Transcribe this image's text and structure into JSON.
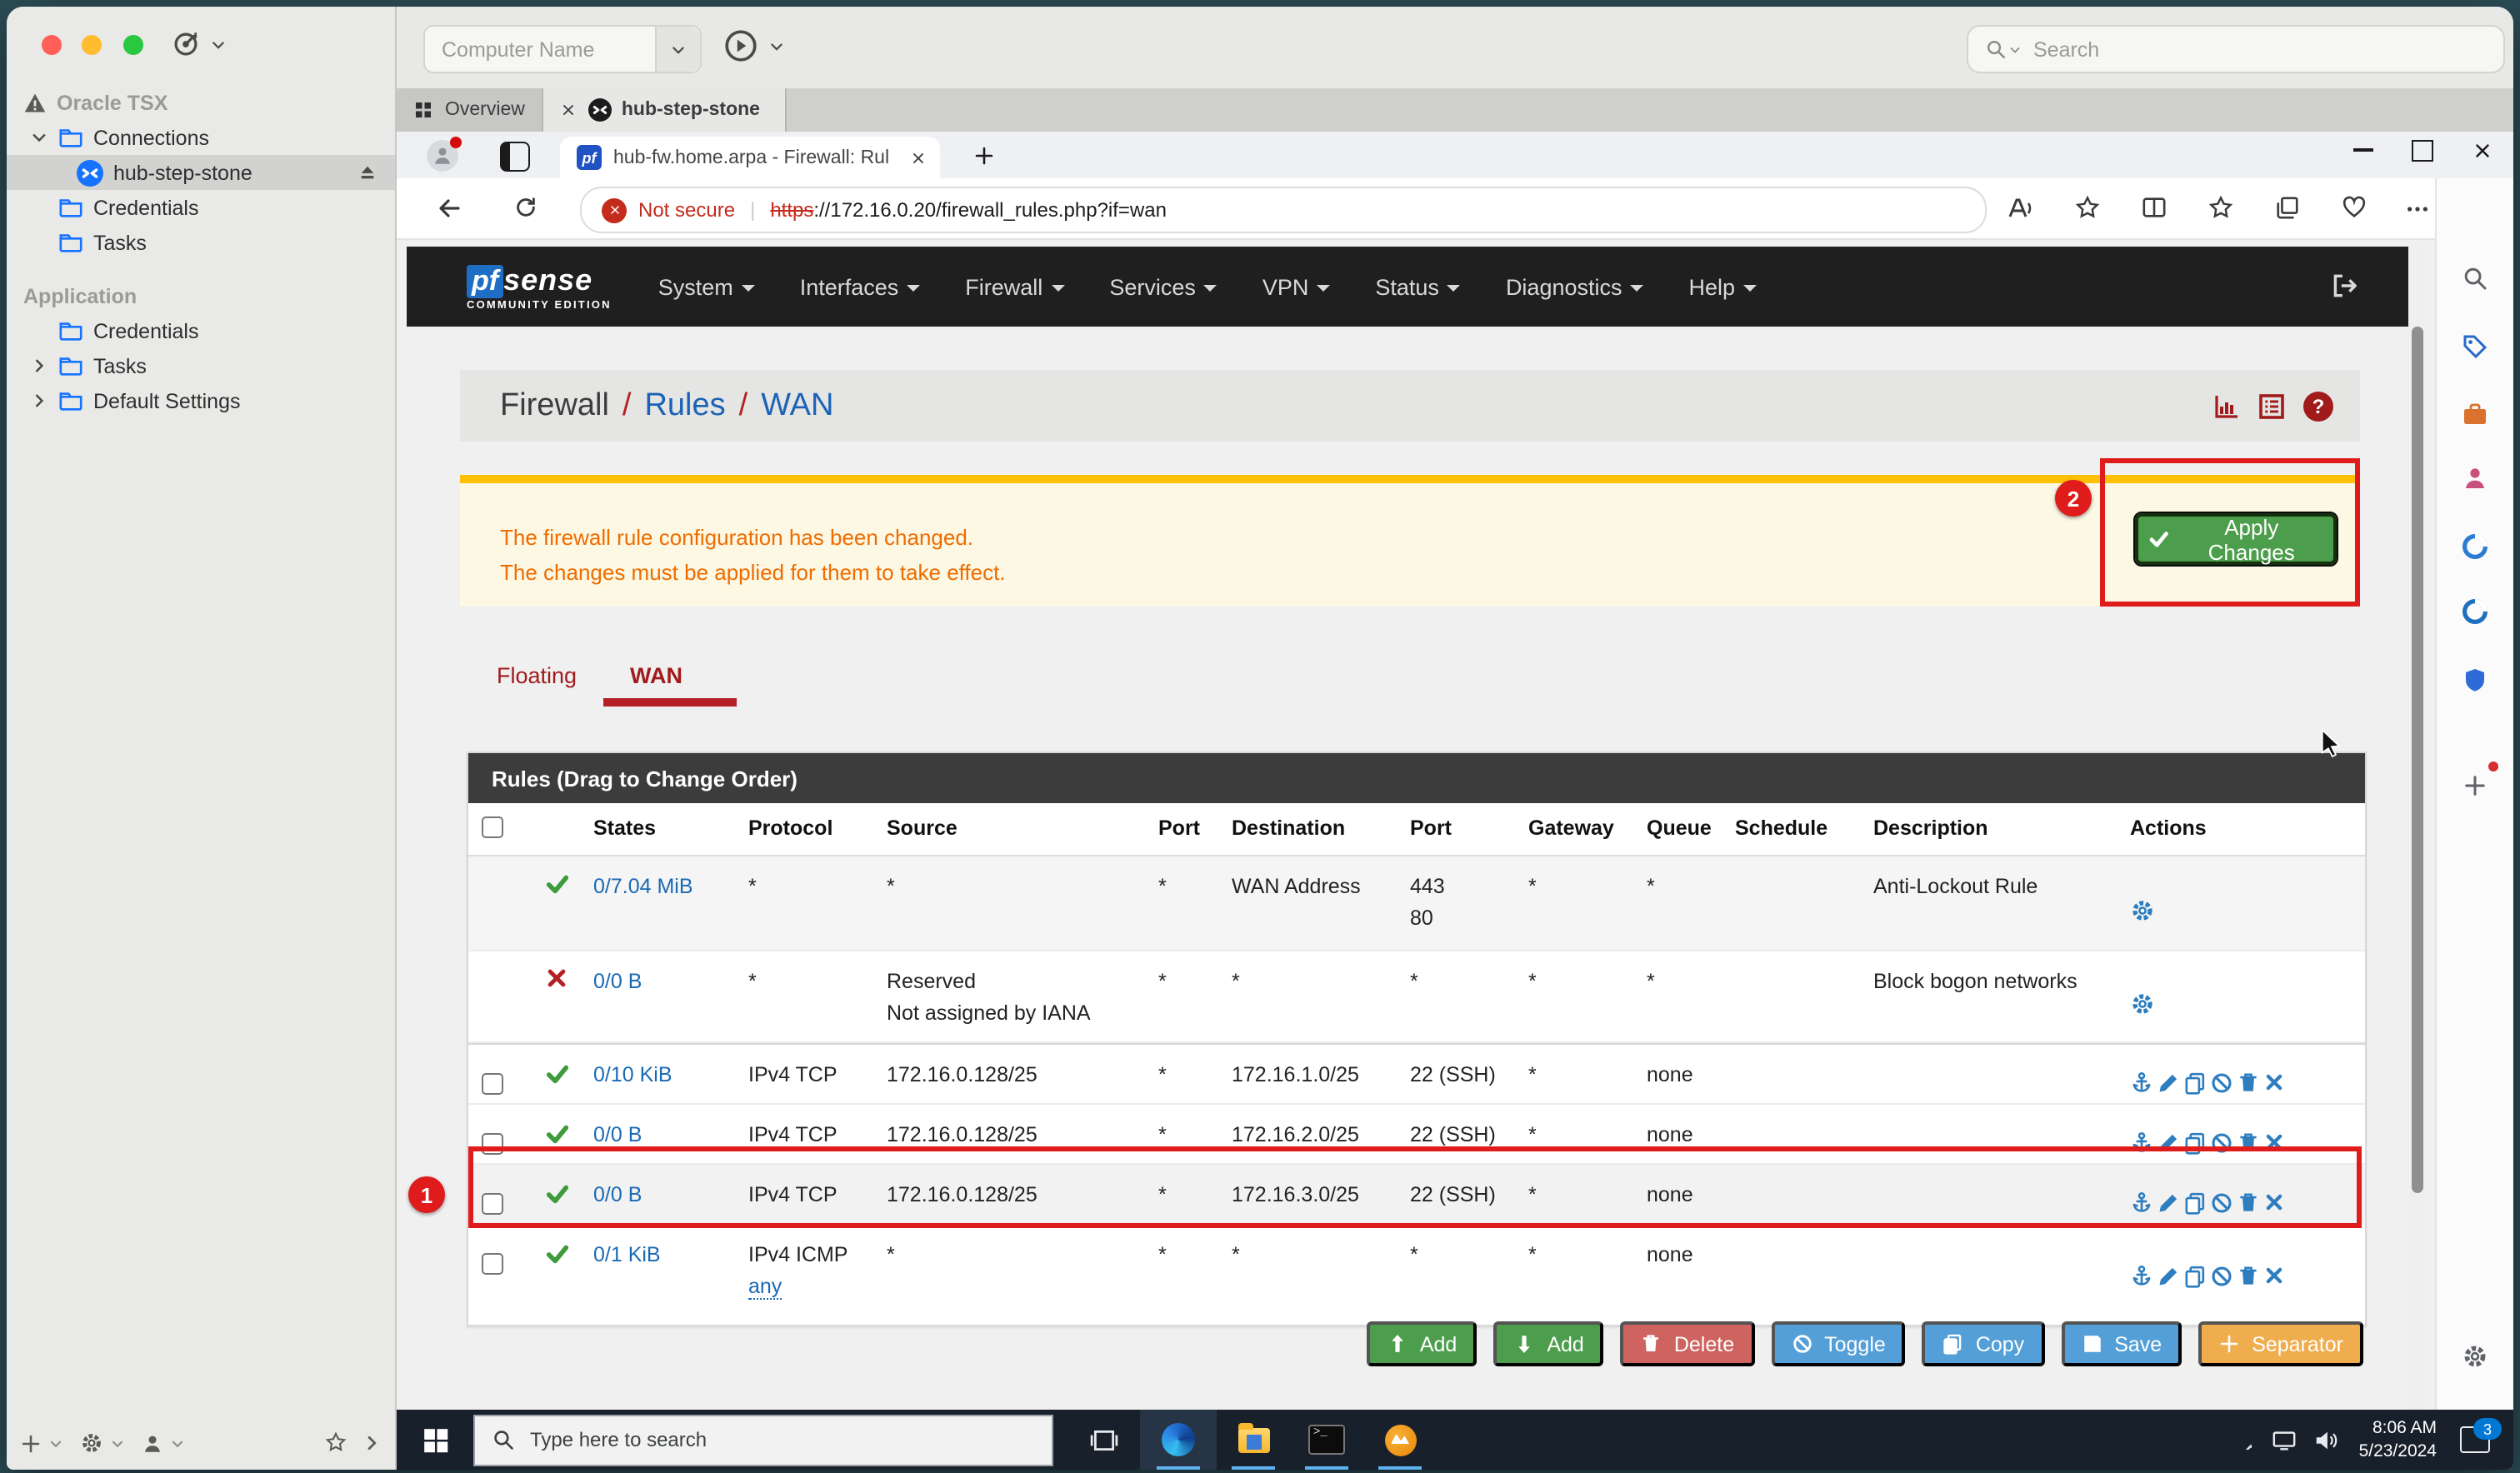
{
  "colors": {
    "wallpaper_teal": "#2d4f58",
    "pfsense_navbar": "#1f1f1f",
    "alert_bg": "#fcf8e3",
    "alert_border": "#ffc107",
    "alert_text": "#ef6c00",
    "success_green": "#4c9e4c",
    "btn_green": "#5cb85c",
    "btn_red": "#d9534f",
    "btn_blue": "#549fd7",
    "btn_orange": "#f0ad4e",
    "annotation_red": "#e01b1b",
    "pf_tab_red": "#a01b1b",
    "pf_icon_red": "#a11b1b",
    "link_blue": "#1a69b5",
    "action_icon_blue": "#2d7dbf",
    "taskbar_bg": "#18202b"
  },
  "connection_manager": {
    "computer_name_placeholder": "Computer Name",
    "search_placeholder": "Search",
    "sidebar": {
      "root_label": "Oracle TSX",
      "connections_label": "Connections",
      "connection_name": "hub-step-stone",
      "credentials_label": "Credentials",
      "tasks_label": "Tasks",
      "section_label": "Application",
      "app_credentials_label": "Credentials",
      "app_tasks_label": "Tasks",
      "app_default_settings_label": "Default Settings"
    },
    "tabs": {
      "overview": "Overview",
      "session": "hub-step-stone"
    }
  },
  "browser": {
    "tab_title": "hub-fw.home.arpa - Firewall: Rul",
    "favicon_text": "pf",
    "security_label": "Not secure",
    "url_scheme": "https",
    "url_rest": "://172.16.0.20/firewall_rules.php?if=wan"
  },
  "pfsense": {
    "logo_prefix": "pf",
    "logo_suffix": "sense",
    "logo_edition": "COMMUNITY EDITION",
    "nav": [
      {
        "label": "System"
      },
      {
        "label": "Interfaces"
      },
      {
        "label": "Firewall"
      },
      {
        "label": "Services"
      },
      {
        "label": "VPN"
      },
      {
        "label": "Status"
      },
      {
        "label": "Diagnostics"
      },
      {
        "label": "Help"
      }
    ],
    "breadcrumb": {
      "section": "Firewall",
      "sep": "/",
      "page": "Rules",
      "interface": "WAN"
    },
    "alert": {
      "line1": "The firewall rule configuration has been changed.",
      "line2": "The changes must be applied for them to take effect.",
      "apply_label": "Apply Changes"
    },
    "tabs": {
      "floating": "Floating",
      "wan": "WAN"
    },
    "panel_title": "Rules (Drag to Change Order)",
    "columns": {
      "states": "States",
      "protocol": "Protocol",
      "source": "Source",
      "port": "Port",
      "destination": "Destination",
      "port2": "Port",
      "gateway": "Gateway",
      "queue": "Queue",
      "schedule": "Schedule",
      "description": "Description",
      "actions": "Actions"
    },
    "rows": [
      {
        "states": "0/7.04 MiB",
        "protocol": "*",
        "source": "*",
        "port": "*",
        "destination": "WAN Address",
        "dest_port_1": "443",
        "dest_port_2": "80",
        "gateway": "*",
        "queue": "*",
        "description": "Anti-Lockout Rule"
      },
      {
        "states": "0/0 B",
        "protocol": "*",
        "source_1": "Reserved",
        "source_2": "Not assigned by IANA",
        "port": "*",
        "destination": "*",
        "dest_port": "*",
        "gateway": "*",
        "queue": "*",
        "description": "Block bogon networks"
      },
      {
        "states": "0/10 KiB",
        "protocol": "IPv4 TCP",
        "source": "172.16.0.128/25",
        "port": "*",
        "destination": "172.16.1.0/25",
        "dest_port": "22 (SSH)",
        "gateway": "*",
        "queue": "none"
      },
      {
        "states": "0/0 B",
        "protocol": "IPv4 TCP",
        "source": "172.16.0.128/25",
        "port": "*",
        "destination": "172.16.2.0/25",
        "dest_port": "22 (SSH)",
        "gateway": "*",
        "queue": "none"
      },
      {
        "states": "0/0 B",
        "protocol": "IPv4 TCP",
        "source": "172.16.0.128/25",
        "port": "*",
        "destination": "172.16.3.0/25",
        "dest_port": "22 (SSH)",
        "gateway": "*",
        "queue": "none"
      },
      {
        "states": "0/1 KiB",
        "protocol": "IPv4 ICMP",
        "protocol_link": "any",
        "source": "*",
        "port": "*",
        "destination": "*",
        "dest_port": "*",
        "gateway": "*",
        "queue": "none"
      }
    ],
    "footer_buttons": {
      "add_up": "Add",
      "add_down": "Add",
      "delete": "Delete",
      "toggle": "Toggle",
      "copy": "Copy",
      "save": "Save",
      "separator": "Separator"
    },
    "annotations": {
      "step1": "1",
      "step2": "2"
    }
  },
  "taskbar": {
    "search_placeholder": "Type here to search",
    "time": "8:06 AM",
    "date": "5/23/2024",
    "notification_count": "3"
  }
}
